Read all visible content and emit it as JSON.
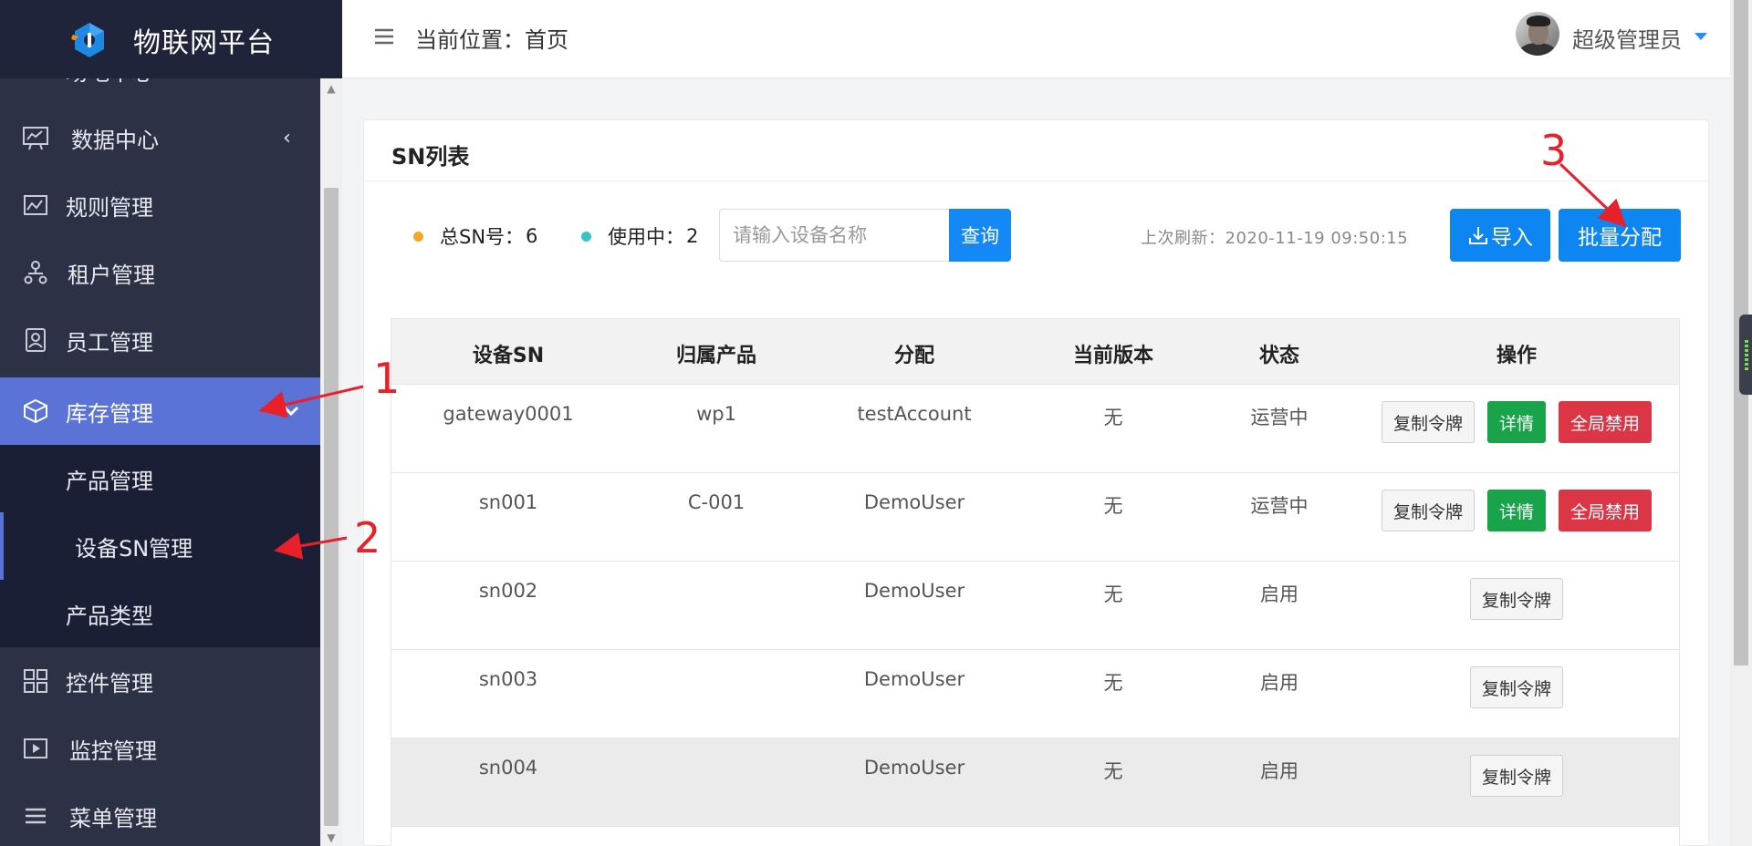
{
  "app": {
    "title": "物联网平台"
  },
  "header": {
    "breadcrumb": "当前位置：首页",
    "user_name": "超级管理员"
  },
  "sidebar": {
    "items": [
      {
        "label": "场地中心",
        "icon": "venue-icon"
      },
      {
        "label": "数据中心",
        "icon": "data-chart-icon",
        "arrow": "‹"
      },
      {
        "label": "规则管理",
        "icon": "rules-icon"
      },
      {
        "label": "租户管理",
        "icon": "tenant-icon"
      },
      {
        "label": "员工管理",
        "icon": "staff-icon"
      },
      {
        "label": "库存管理",
        "icon": "box-icon",
        "arrow": "⌄",
        "active": true
      },
      {
        "label": "产品管理",
        "sub": true
      },
      {
        "label": "设备SN管理",
        "sub": true,
        "current": true
      },
      {
        "label": "产品类型",
        "sub": true
      },
      {
        "label": "控件管理",
        "icon": "widgets-icon"
      },
      {
        "label": "监控管理",
        "icon": "monitor-icon"
      },
      {
        "label": "菜单管理",
        "icon": "menu-icon"
      }
    ]
  },
  "card": {
    "title": "SN列表",
    "stats": {
      "total_label": "总SN号：",
      "total_value": "6",
      "inuse_label": "使用中：",
      "inuse_value": "2",
      "total_dot_color": "#f5a623",
      "inuse_dot_color": "#36c5c0"
    },
    "search": {
      "placeholder": "请输入设备名称",
      "button": "查询"
    },
    "refresh_label": "上次刷新：",
    "refresh_time": "2020-11-19 09:50:15",
    "import_button": "导入",
    "batch_button": "批量分配"
  },
  "table": {
    "headers": [
      "设备SN",
      "归属产品",
      "分配",
      "当前版本",
      "状态",
      "操作"
    ],
    "rows": [
      {
        "sn": "gateway0001",
        "product": "wp1",
        "assign": "testAccount",
        "version": "无",
        "status": "运营中",
        "actions": [
          "复制令牌",
          "详情",
          "全局禁用"
        ]
      },
      {
        "sn": "sn001",
        "product": "C-001",
        "assign": "DemoUser",
        "version": "无",
        "status": "运营中",
        "actions": [
          "复制令牌",
          "详情",
          "全局禁用"
        ]
      },
      {
        "sn": "sn002",
        "product": "",
        "assign": "DemoUser",
        "version": "无",
        "status": "启用",
        "actions": [
          "复制令牌"
        ]
      },
      {
        "sn": "sn003",
        "product": "",
        "assign": "DemoUser",
        "version": "无",
        "status": "启用",
        "actions": [
          "复制令牌"
        ]
      },
      {
        "sn": "sn004",
        "product": "",
        "assign": "DemoUser",
        "version": "无",
        "status": "启用",
        "actions": [
          "复制令牌"
        ]
      }
    ]
  },
  "annotations": {
    "one": "1",
    "two": "2",
    "three": "3",
    "color": "#e8202a"
  },
  "colors": {
    "sidebar_bg": "#2c3145",
    "active_menu": "#5b72d6",
    "primary": "#0d86f2",
    "success": "#19a34a",
    "danger": "#dc3545"
  }
}
